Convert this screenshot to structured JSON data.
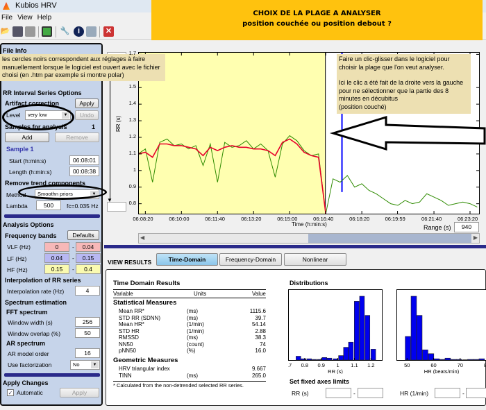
{
  "window": {
    "title": "Kubios HRV"
  },
  "menu": [
    "File",
    "View",
    "Help"
  ],
  "toolbar": [
    "open-icon",
    "save-icon",
    "print-icon",
    "report-icon",
    "settings-icon",
    "info-icon",
    "bookmark-icon",
    "close-icon"
  ],
  "banner": {
    "line1": "CHOIX DE LA PLAGE  A ANALYSER",
    "line2": "position couchée   ou position  debout  ?"
  },
  "callouts": {
    "left": "les cercles noirs correspondent aux réglages à faire manuellement lorsque le logiciel est ouvert avec le fichier choisi (en .htm par exemple si montre polar)",
    "right_1": "Faire un clic-glisser dans le logiciel pour choisir la plage que l'on veut analyser.",
    "right_2": "Ici le clic a été fait de la droite vers la gauche pour ne sélectionner que la partie des 8 minutes en  décubitus",
    "right_3": " (position couché)"
  },
  "left_panel": {
    "file_info": "File Info",
    "rr_options": "RR Interval Series Options",
    "artifact": "Artifact correction",
    "apply": "Apply",
    "level_label": "Level",
    "level_value": "very low",
    "undo": "Undo",
    "samples": "Samples for analysis",
    "samples_count": "1",
    "add": "Add",
    "remove": "Remove",
    "sample_name": "Sample 1",
    "start_label": "Start (h:min:s)",
    "start": "06:08:01",
    "length_label": "Length (h:min:s)",
    "length": "00:08:38",
    "trend": "Remove trend components",
    "method_label": "Method",
    "method_value": "Smoothn priors",
    "lambda_label": "Lambda",
    "lambda": "500",
    "fc": "fc=0.035 Hz",
    "analysis": "Analysis Options",
    "bands": "Frequency bands",
    "defaults": "Defaults",
    "vlf_label": "VLF (Hz)",
    "vlf": [
      "0",
      "0.04"
    ],
    "lf_label": "LF (Hz)",
    "lf": [
      "0.04",
      "0.15"
    ],
    "hf_label": "HF (Hz)",
    "hf": [
      "0.15",
      "0.4"
    ],
    "vlf_color": "#f7b8b8",
    "lf_color": "#b8b8f2",
    "hf_color": "#fafab0",
    "interp": "Interpolation of RR series",
    "interp_label": "Interpolation rate (Hz)",
    "interp_value": "4",
    "spectrum": "Spectrum estimation",
    "fft": "FFT spectrum",
    "ww_label": "Window width (s)",
    "ww": "256",
    "wo_label": "Window overlap (%)",
    "wo": "50",
    "ar": "AR spectrum",
    "ar_label": "AR model order",
    "ar_value": "16",
    "fact_label": "Use factorization",
    "fact_value": "No",
    "apply_changes": "Apply Changes",
    "automatic": "Automatic",
    "automatic_checked": true,
    "apply2": "Apply"
  },
  "main_plot": {
    "ylabel": "RR (s)",
    "xlabel": "Time (h:min:s)",
    "range_label": "Range (s)",
    "range": "940"
  },
  "view": {
    "label": "VIEW RESULTS",
    "tabs": [
      "Time-Domain",
      "Frequency-Domain",
      "Nonlinear"
    ],
    "active": 0
  },
  "time_domain": {
    "title": "Time Domain Results",
    "cols": [
      "Variable",
      "Units",
      "Value"
    ],
    "stat_title": "Statistical Measures",
    "stat": [
      [
        "Mean RR*",
        "(ms)",
        "1115.6"
      ],
      [
        "STD RR (SDNN)",
        "(ms)",
        "39.7"
      ],
      [
        "Mean HR*",
        "(1/min)",
        "54.14"
      ],
      [
        "STD HR",
        "(1/min)",
        "2.88"
      ],
      [
        "RMSSD",
        "(ms)",
        "38.3"
      ],
      [
        "NN50",
        "(count)",
        "74"
      ],
      [
        "pNN50",
        "(%)",
        "16.0"
      ]
    ],
    "geo_title": "Geometric Measures",
    "geo": [
      [
        "HRV triangular index",
        "",
        "9.667"
      ],
      [
        "TINN",
        "(ms)",
        "265.0"
      ]
    ],
    "footnote": "* Calculated from the non-detrended selected RR series."
  },
  "distributions": {
    "title": "Distributions",
    "rr_xlabel": "RR (s)",
    "hr_xlabel": "HR (beats/min)",
    "fixed": "Set fixed axes limits",
    "rr_label": "RR (s)",
    "hr_label": "HR (1/min)"
  },
  "chart_data": [
    {
      "type": "line",
      "xlabel": "Time (h:min:s)",
      "ylabel": "RR (s)",
      "ylim": [
        0.74,
        1.71
      ],
      "xlim": [
        "06:08:02",
        "06:23:45"
      ],
      "yticks": [
        "0.8",
        "0.9",
        "1",
        "1.1",
        "1.2",
        "1.3",
        "1.4",
        "1.5",
        "1.7"
      ],
      "xticks": [
        "06:08:20",
        "06:10:00",
        "06:11:40",
        "06:13:20",
        "06:15:00",
        "06:16:40",
        "06:18:20",
        "06:19:59",
        "06:21:40",
        "06:23:20"
      ],
      "selection": [
        "06:08:01",
        "06:16:39"
      ],
      "selection_color": "#ffffb0",
      "x": [
        "06:08:00",
        "06:08:20",
        "06:08:40",
        "06:09:00",
        "06:09:20",
        "06:09:40",
        "06:10:00",
        "06:10:20",
        "06:10:40",
        "06:11:00",
        "06:11:20",
        "06:11:40",
        "06:12:00",
        "06:12:20",
        "06:12:40",
        "06:13:00",
        "06:13:20",
        "06:13:40",
        "06:14:00",
        "06:14:20",
        "06:14:40",
        "06:15:00",
        "06:15:20",
        "06:15:40",
        "06:16:00",
        "06:16:20",
        "06:16:40",
        "06:17:00",
        "06:17:20",
        "06:17:40",
        "06:18:00",
        "06:18:20",
        "06:18:40",
        "06:19:00",
        "06:19:20",
        "06:19:40",
        "06:20:00",
        "06:20:20",
        "06:20:40",
        "06:21:00",
        "06:21:20",
        "06:21:40",
        "06:22:00",
        "06:22:20",
        "06:22:40",
        "06:23:00",
        "06:23:20",
        "06:23:40"
      ],
      "series": [
        {
          "color": "#2e8b00",
          "values": [
            1.1,
            1.13,
            0.93,
            1.17,
            1.19,
            1.15,
            1.16,
            1.13,
            1.15,
            1.03,
            1.16,
            0.93,
            1.17,
            1.14,
            1.15,
            1.18,
            1.13,
            1.16,
            1.12,
            0.96,
            1.16,
            1.21,
            1.18,
            1.12,
            1.09,
            1.1,
            0.74,
            0.95,
            0.93,
            0.97,
            0.9,
            0.92,
            0.88,
            0.86,
            0.83,
            0.8,
            0.79,
            0.82,
            0.8,
            0.81,
            0.86,
            0.84,
            0.82,
            0.79,
            0.8,
            0.81,
            0.8,
            0.78
          ]
        },
        {
          "color": "#e8002a",
          "values": [
            1.1,
            1.11,
            1.08,
            1.16,
            1.16,
            1.15,
            1.15,
            1.14,
            1.13,
            1.09,
            1.14,
            1.12,
            1.14,
            1.15,
            1.14,
            1.14,
            1.13,
            1.13,
            1.12,
            1.09,
            1.17,
            1.19,
            1.16,
            1.11,
            1.09,
            1.08,
            0.74
          ]
        }
      ]
    },
    {
      "type": "bar",
      "xlabel": "RR (s)",
      "xlim": [
        0.7,
        1.27
      ],
      "xticks": [
        "0.7",
        "0.8",
        "0.9",
        "1",
        "1.1",
        "1.2"
      ],
      "x": [
        0.763,
        0.794,
        0.828,
        0.86,
        0.893,
        0.92,
        0.95,
        0.986,
        1.02,
        1.05,
        1.08,
        1.115,
        1.147,
        1.18,
        1.215
      ],
      "values_percent_of_max": [
        6,
        2,
        2,
        1,
        1,
        4,
        3,
        2,
        7,
        20,
        28,
        92,
        100,
        70,
        17
      ],
      "color": "#0000ee"
    },
    {
      "type": "bar",
      "xlabel": "HR (beats/min)",
      "xlim": [
        46,
        80
      ],
      "xticks": [
        "50",
        "60",
        "70",
        "80"
      ],
      "x": [
        50.4,
        52.6,
        54.7,
        56.9,
        59.1,
        61.2,
        63.3,
        65.4,
        67.6,
        69.7,
        72.1,
        73.9,
        76,
        78.2
      ],
      "values_percent_of_max": [
        37,
        100,
        70,
        16,
        10,
        2,
        1,
        3,
        1,
        1,
        0.5,
        1,
        1,
        2
      ],
      "color": "#0000ee"
    }
  ]
}
